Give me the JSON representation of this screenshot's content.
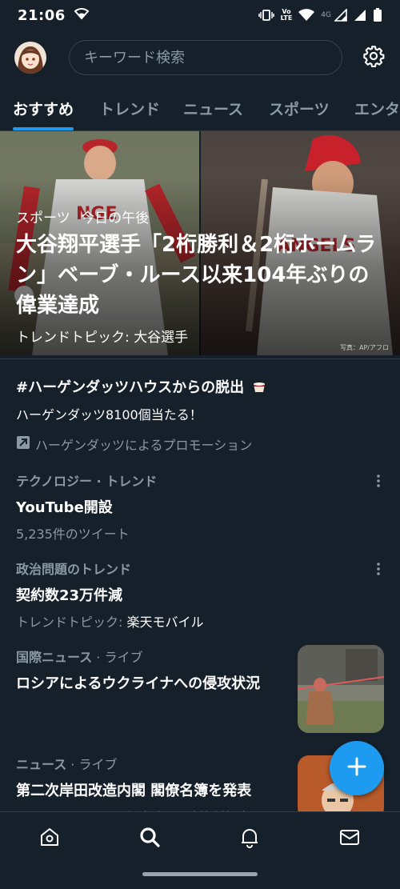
{
  "status_bar": {
    "time": "21:06",
    "volte_top": "Vo",
    "volte_bottom": "LTE",
    "network": "4G"
  },
  "search": {
    "placeholder": "キーワード検索"
  },
  "tabs": [
    {
      "label": "おすすめ",
      "active": true
    },
    {
      "label": "トレンド",
      "active": false
    },
    {
      "label": "ニュース",
      "active": false
    },
    {
      "label": "スポーツ",
      "active": false
    },
    {
      "label": "エンタ",
      "active": false
    }
  ],
  "hero": {
    "category": "スポーツ",
    "time": "今日の午後",
    "title": "大谷翔平選手「2桁勝利＆2桁ホームラン」ベーブ・ルース以来104年ぶりの偉業達成",
    "topic": "トレンドトピック: 大谷選手",
    "credit": "写真：AP/アフロ"
  },
  "promo": {
    "title": "#ハーゲンダッツハウスからの脱出",
    "description": "ハーゲンダッツ8100個当たる！",
    "label": "ハーゲンダッツによるプロモーション"
  },
  "trends": [
    {
      "category": "テクノロジー · トレンド",
      "title": "YouTube開設",
      "sub": "5,235件のツイート"
    },
    {
      "category": "政治問題のトレンド",
      "title": "契約数23万件減",
      "sub_prefix": "トレンドトピック: ",
      "sub_highlight": "楽天モバイル"
    }
  ],
  "news": [
    {
      "category": "国際ニュース",
      "live": " · ライブ",
      "title": "ロシアによるウクライナへの侵攻状況"
    },
    {
      "category": "ニュース",
      "live": " · ライブ",
      "title": "第二次岸田改造内閣 閣僚名簿を発表",
      "sub": "トレンドトピック: 記者会見, 政策断行内閣"
    }
  ],
  "colors": {
    "background": "#15202b",
    "accent": "#1d9bf0",
    "secondary_text": "#8b98a5",
    "divider": "#2f3c47"
  },
  "icons": {
    "nav": [
      "home-icon",
      "search-icon",
      "bell-icon",
      "mail-icon"
    ],
    "fab": "plus-icon",
    "settings": "gear-icon"
  }
}
